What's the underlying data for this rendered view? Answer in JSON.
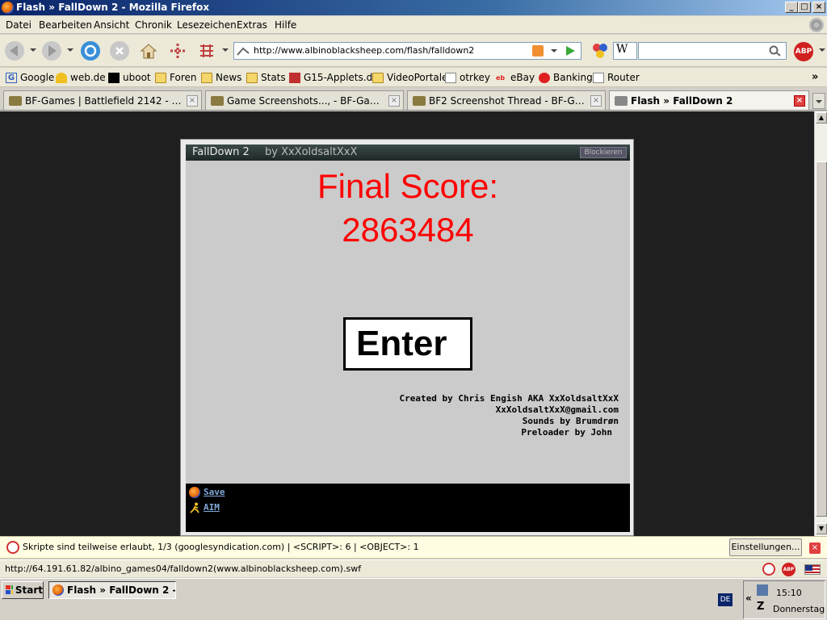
{
  "window": {
    "title": "Flash » FallDown 2 - Mozilla Firefox",
    "minimize": "_",
    "maximize": "□",
    "close": "×"
  },
  "menu": [
    "Datei",
    "Bearbeiten",
    "Ansicht",
    "Chronik",
    "Lesezeichen",
    "Extras",
    "Hilfe"
  ],
  "address": {
    "url": "http://www.albinoblacksheep.com/flash/falldown2"
  },
  "search": {
    "engine_letter": "W",
    "value": ""
  },
  "abp_label": "ABP",
  "bookmarks": [
    {
      "label": "Google",
      "icon": "google-icon"
    },
    {
      "label": "web.de",
      "icon": "webde-icon"
    },
    {
      "label": "uboot",
      "icon": "uboot-icon"
    },
    {
      "label": "Foren",
      "icon": "folder-icon"
    },
    {
      "label": "News",
      "icon": "folder-icon"
    },
    {
      "label": "Stats",
      "icon": "folder-icon"
    },
    {
      "label": "G15-Applets.de",
      "icon": "g15-icon"
    },
    {
      "label": "VideoPortale",
      "icon": "folder-icon"
    },
    {
      "label": "otrkey",
      "icon": "otrkey-icon"
    },
    {
      "label": "eBay",
      "icon": "ebay-icon"
    },
    {
      "label": "Banking",
      "icon": "sparkasse-icon"
    },
    {
      "label": "Router",
      "icon": "page-icon"
    }
  ],
  "bookmarks_more": "»",
  "tabs": [
    {
      "label": "BF-Games | Battlefield 2142 - Battlefie...",
      "active": false
    },
    {
      "label": "Game Screenshots..., - BF-Games.net...",
      "active": false
    },
    {
      "label": "BF2 Screenshot Thread - BF-Games.n...",
      "active": false
    },
    {
      "label": "Flash » FallDown 2",
      "active": true
    }
  ],
  "game": {
    "title": "FallDown 2",
    "by": "by XxXoldsaltXxX",
    "block_label": "Blockieren",
    "final_label": "Final Score:",
    "final_score": "2863484",
    "enter_label": "Enter",
    "credits": [
      "Created by Chris Engish AKA XxXoldsaltXxX",
      "XxXoldsaltXxX@gmail.com",
      "Sounds by Brumdrøn",
      "Preloader by John"
    ],
    "links": [
      "Save",
      "AIM"
    ]
  },
  "notification": {
    "text": "Skripte sind teilweise erlaubt, 1/3 (googlesyndication.com) | <SCRIPT>: 6 | <OBJECT>: 1",
    "button": "Einstellungen...",
    "close": "×"
  },
  "status": {
    "text": "http://64.191.61.82/albino_games04/falldown2(www.albinoblacksheep.com).swf"
  },
  "taskbar": {
    "start": "Start",
    "item": "Flash » FallDown 2 - ...",
    "lang": "DE",
    "chevron": "«",
    "time": "15:10",
    "day": "Donnerstag"
  },
  "colors": {
    "score_red": "#ff0000",
    "stage_gray": "#cbcbcb",
    "page_bg": "#1f1f1f"
  }
}
